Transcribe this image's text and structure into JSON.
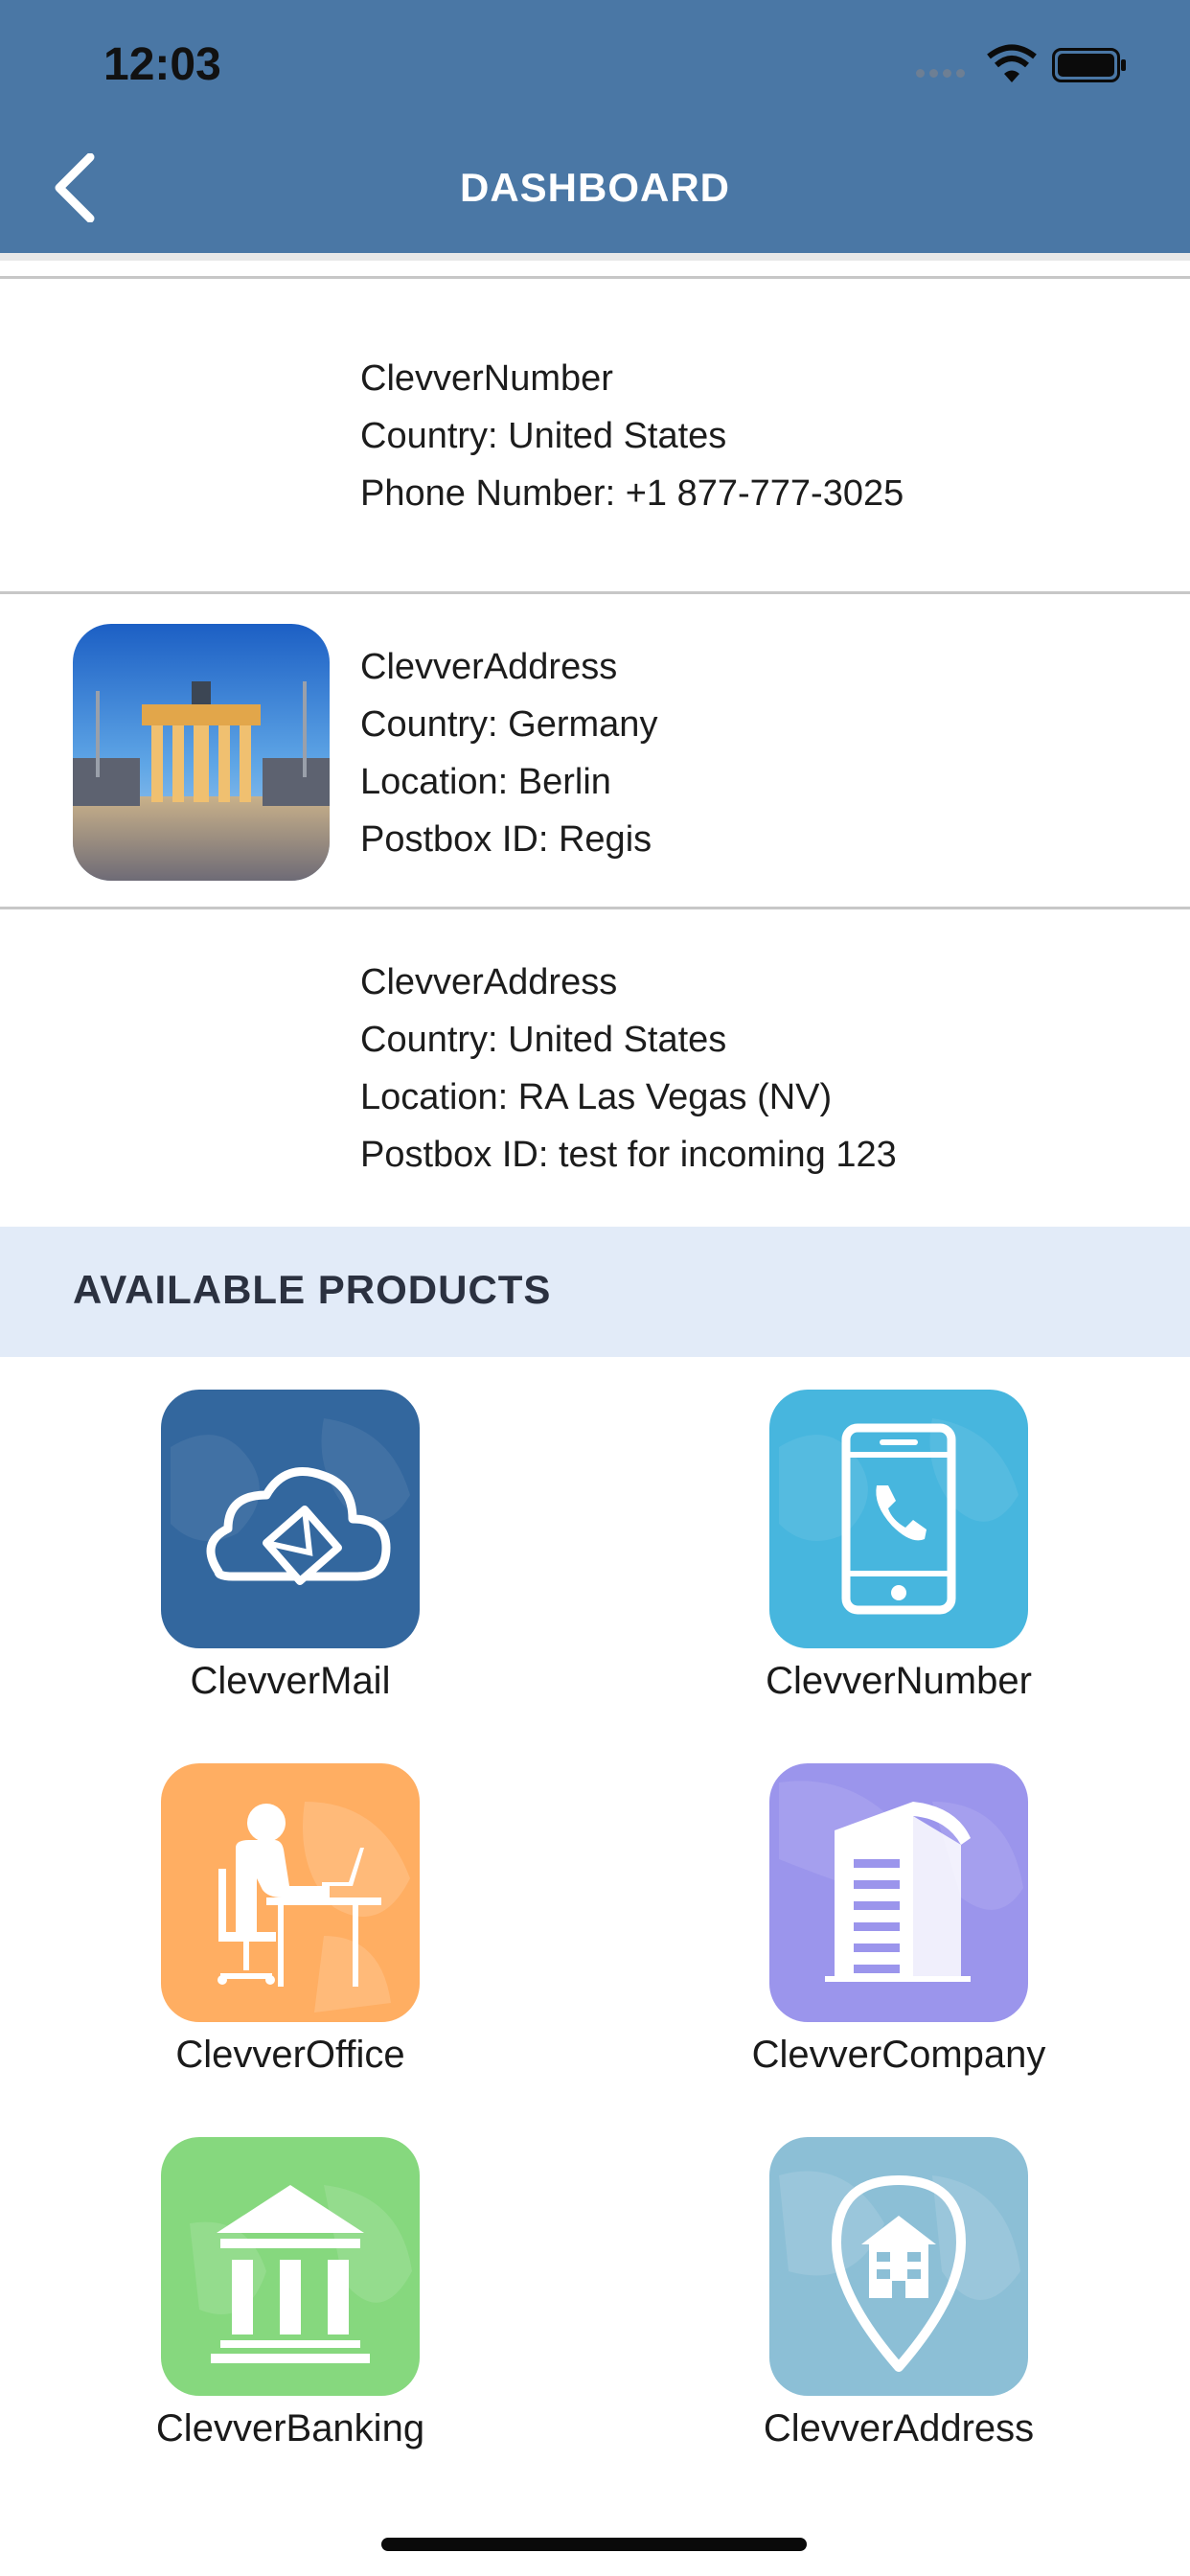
{
  "status_bar": {
    "time": "12:03"
  },
  "header": {
    "title": "DASHBOARD"
  },
  "subscriptions": [
    {
      "lines": [
        "ClevverNumber",
        "Country: United States",
        "Phone Number: +1 877-777-3025"
      ]
    },
    {
      "lines": [
        "ClevverAddress",
        "Country: Germany",
        "Location: Berlin",
        "Postbox ID: Regis"
      ]
    },
    {
      "lines": [
        "ClevverAddress",
        "Country: United States",
        "Location: RA Las Vegas (NV)",
        "Postbox ID: test for incoming 123"
      ]
    }
  ],
  "products_section": {
    "title": "AVAILABLE PRODUCTS"
  },
  "products": [
    {
      "label": "ClevverMail",
      "color": "#33679e",
      "icon": "cloud-mail-icon"
    },
    {
      "label": "ClevverNumber",
      "color": "#47b6de",
      "icon": "phone-icon"
    },
    {
      "label": "ClevverOffice",
      "color": "#ffae62",
      "icon": "office-worker-icon"
    },
    {
      "label": "ClevverCompany",
      "color": "#9b95ec",
      "icon": "building-icon"
    },
    {
      "label": "ClevverBanking",
      "color": "#86d87e",
      "icon": "bank-icon"
    },
    {
      "label": "ClevverAddress",
      "color": "#8cbfd6",
      "icon": "location-pin-icon"
    }
  ]
}
